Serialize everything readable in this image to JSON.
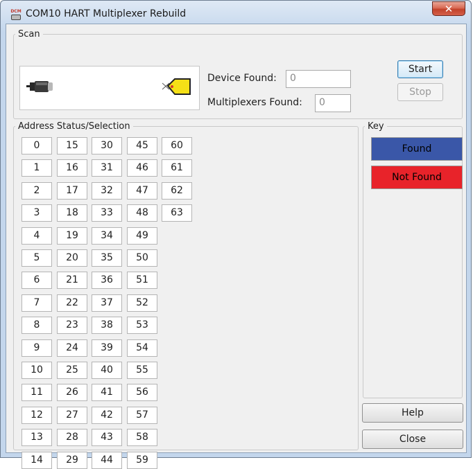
{
  "window": {
    "title": "COM10 HART Multiplexer Rebuild",
    "icon_text": "DCM",
    "close_glyph": "✕"
  },
  "scan": {
    "legend": "Scan",
    "device_found_label": "Device Found:",
    "device_found_value": "0",
    "multiplexers_found_label": "Multiplexers Found:",
    "multiplexers_found_value": "0",
    "start_label": "Start",
    "stop_label": "Stop",
    "modem_icon": "hart-modem-icon",
    "tag_icon": "device-tag-icon"
  },
  "address": {
    "legend": "Address Status/Selection",
    "columns": [
      [
        "0",
        "1",
        "2",
        "3",
        "4",
        "5",
        "6",
        "7",
        "8",
        "9",
        "10",
        "11",
        "12",
        "13",
        "14"
      ],
      [
        "15",
        "16",
        "17",
        "18",
        "19",
        "20",
        "21",
        "22",
        "23",
        "24",
        "25",
        "26",
        "27",
        "28",
        "29"
      ],
      [
        "30",
        "31",
        "32",
        "33",
        "34",
        "35",
        "36",
        "37",
        "38",
        "39",
        "40",
        "41",
        "42",
        "43",
        "44"
      ],
      [
        "45",
        "46",
        "47",
        "48",
        "49",
        "50",
        "51",
        "52",
        "53",
        "54",
        "55",
        "56",
        "57",
        "58",
        "59"
      ],
      [
        "60",
        "61",
        "62",
        "63"
      ]
    ]
  },
  "key": {
    "legend": "Key",
    "found_label": "Found",
    "found_color": "#3a57a8",
    "not_found_label": "Not Found",
    "not_found_color": "#e8232a"
  },
  "buttons": {
    "help_label": "Help",
    "close_label": "Close"
  }
}
